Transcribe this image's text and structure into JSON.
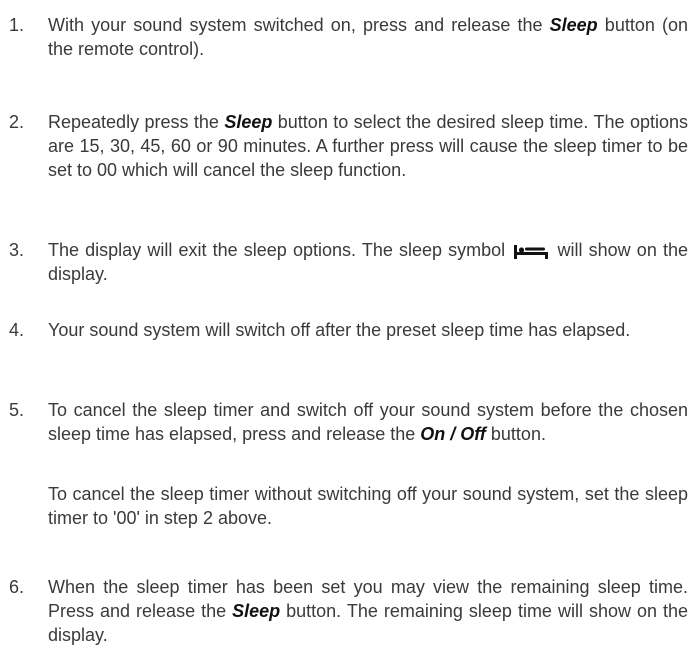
{
  "steps": [
    {
      "number": "1.",
      "t1": "With your sound system switched on, press and release the ",
      "k1": "Sleep",
      "t2": " button (on the remote control)."
    },
    {
      "number": "2.",
      "t1": "Repeatedly press the ",
      "k1": "Sleep",
      "t2": " button to select the desired sleep time. The options are 15, 30, 45, 60 or 90 minutes. A further press will cause the sleep timer to be set to 00 which will cancel the sleep function."
    },
    {
      "number": "3.",
      "t1": "The display will exit the sleep options. The sleep symbol",
      "icon": "bed-icon",
      "t2": "will show on the display."
    },
    {
      "number": "4.",
      "t1": "Your sound system will switch off after the preset sleep time has elapsed."
    },
    {
      "number": "5.",
      "t1": "To cancel the sleep timer and switch off your sound system before the chosen sleep time has elapsed, press and release the ",
      "k1": "On / Off",
      "t2": " button.",
      "note": "To cancel the sleep timer without switching off your sound system, set the sleep timer to '00' in step 2 above."
    },
    {
      "number": "6.",
      "t1": "When the sleep timer has been set you may view the remaining sleep time. Press and release the ",
      "k1": "Sleep",
      "t2": " button. The remaining sleep time will show on the display."
    }
  ],
  "colors": {
    "text": "#3a3a3a",
    "keyword": "#111111"
  }
}
